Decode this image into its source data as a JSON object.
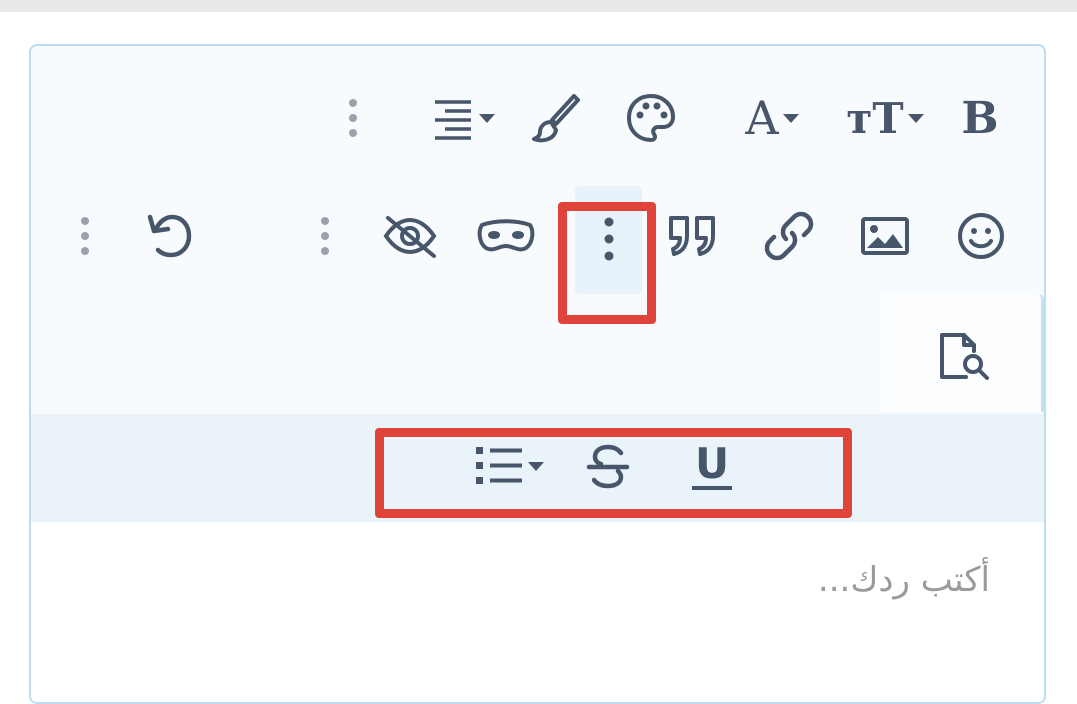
{
  "toolbar": {
    "bold_label": "B",
    "font_size_label": "тT",
    "font_color_label": "A",
    "underline_label": "U"
  },
  "editor": {
    "placeholder": "أكتب ردك..."
  },
  "colors": {
    "icon": "#47566a",
    "border": "#bcdcef",
    "subbar_bg": "#eaf3fa",
    "highlight": "#e0433a",
    "placeholder": "#9a9a9a"
  },
  "icons": [
    "bold-icon",
    "text-size-icon",
    "font-color-icon",
    "palette-icon",
    "paint-brush-icon",
    "align-icon",
    "more-vertical-icon",
    "smiley-icon",
    "image-icon",
    "link-icon",
    "quote-icon",
    "mask-icon",
    "eye-slash-icon",
    "undo-icon",
    "file-search-icon",
    "underline-icon",
    "strikethrough-icon",
    "list-icon"
  ]
}
